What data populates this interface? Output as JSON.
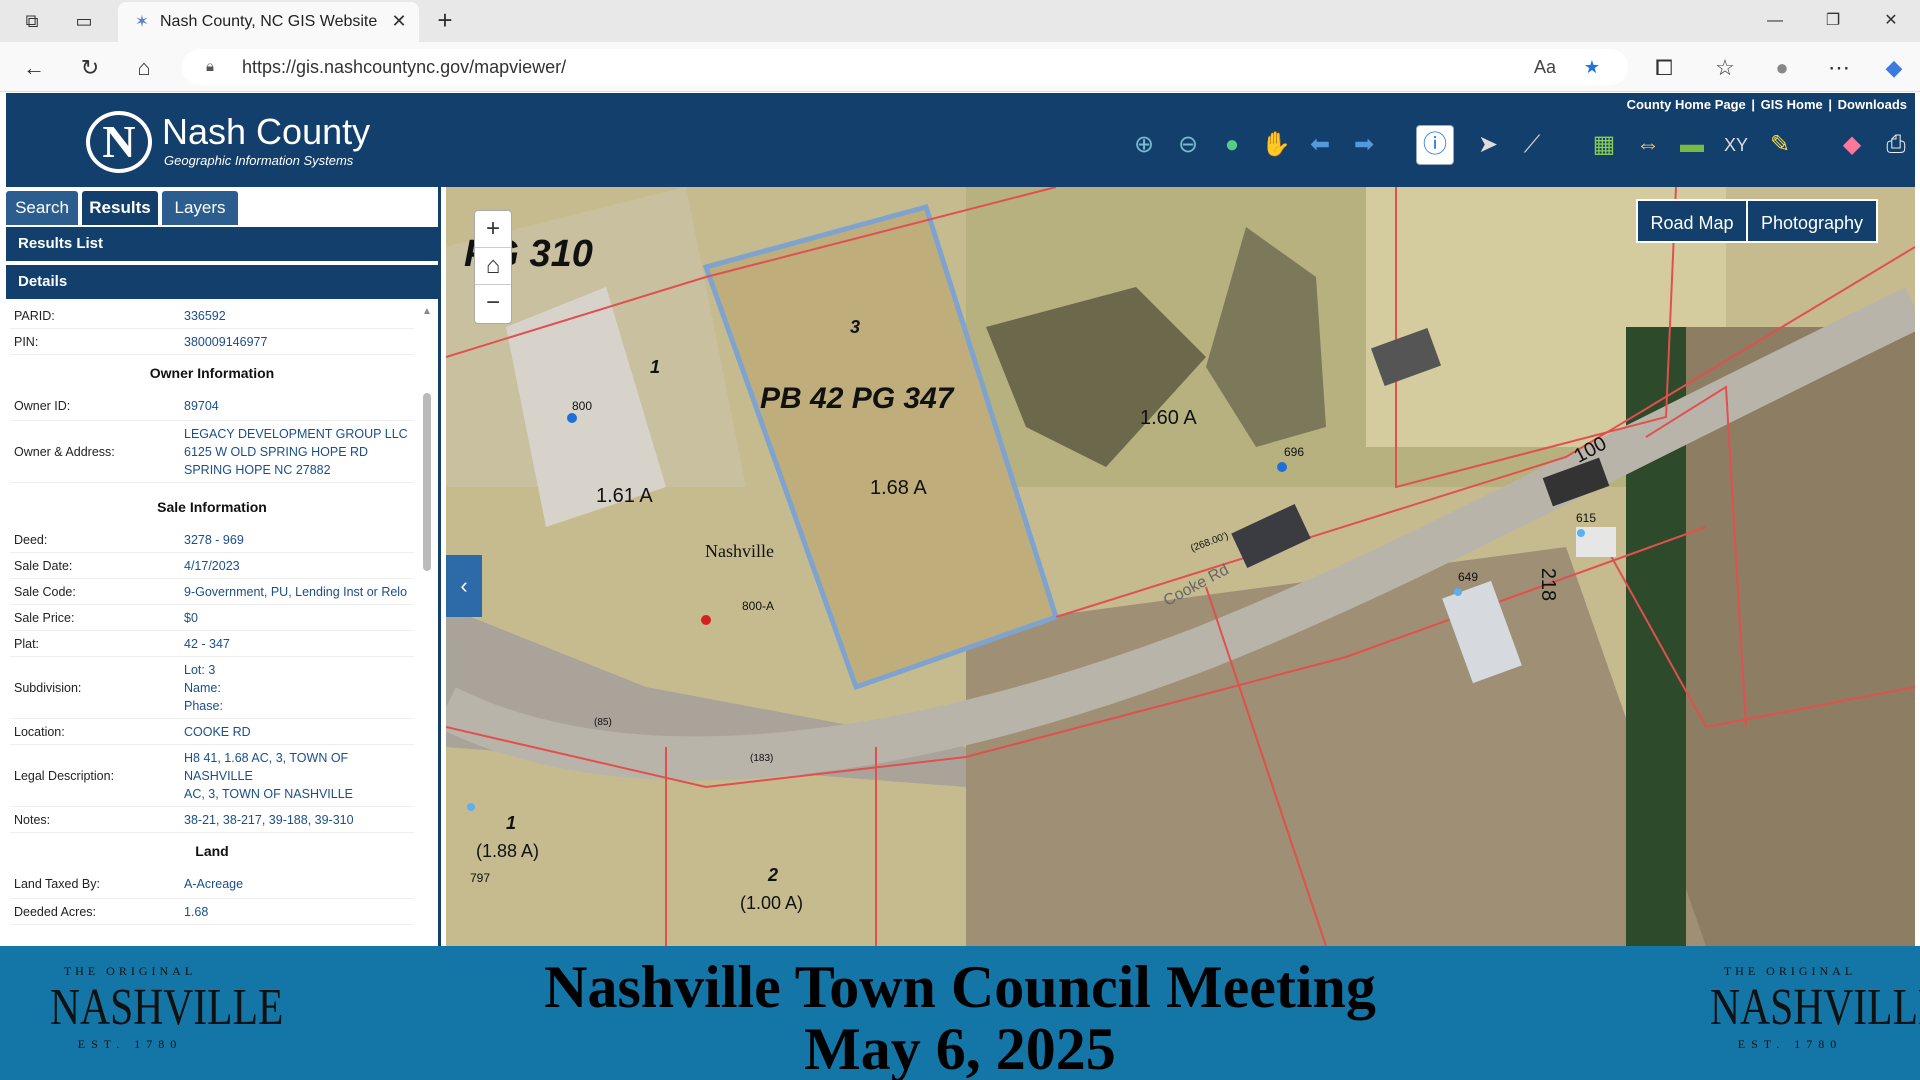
{
  "browser": {
    "tab_title": "Nash County, NC GIS Website",
    "url": "https://gis.nashcountync.gov/mapviewer/"
  },
  "header": {
    "logo_name": "Nash County",
    "logo_sub": "Geographic Information Systems",
    "links": [
      "County Home Page",
      "GIS Home",
      "Downloads"
    ],
    "tools": [
      "zoom-in-icon",
      "zoom-out-icon",
      "globe-icon",
      "pan-hand-icon",
      "back-arrow-icon",
      "forward-arrow-icon",
      "info-icon",
      "select-pointer-icon",
      "measure-icon",
      "map-icon",
      "distance-icon",
      "layer-icon",
      "xy-icon",
      "pencil-icon",
      "eraser-icon",
      "print-icon"
    ]
  },
  "panel": {
    "tabs": [
      "Search",
      "Results",
      "Layers"
    ],
    "selected_tab": "Results",
    "results_list_label": "Results List",
    "details_label": "Details",
    "parid_label": "PARID:",
    "parid": "336592",
    "pin_label": "PIN:",
    "pin": "380009146977",
    "owner_heading": "Owner Information",
    "owner_id_label": "Owner ID:",
    "owner_id": "89704",
    "owner_address_label": "Owner & Address:",
    "owner_line1": "LEGACY DEVELOPMENT GROUP LLC",
    "owner_line2": "6125 W OLD SPRING HOPE RD",
    "owner_line3": "SPRING HOPE NC 27882",
    "sale_heading": "Sale Information",
    "deed_label": "Deed:",
    "deed": "3278 - 969",
    "sale_date_label": "Sale Date:",
    "sale_date": "4/17/2023",
    "sale_code_label": "Sale Code:",
    "sale_code": "9-Government, PU, Lending Inst or Relo",
    "sale_price_label": "Sale Price:",
    "sale_price": "$0",
    "plat_label": "Plat:",
    "plat": "42 - 347",
    "subdivision_label": "Subdivision:",
    "sub_lot": "Lot: 3",
    "sub_name": "Name:",
    "sub_phase": "Phase:",
    "location_label": "Location:",
    "location": "COOKE RD",
    "legal_label": "Legal Description:",
    "legal1": "H8 41, 1.68 AC, 3, TOWN OF",
    "legal2": "NASHVILLE",
    "legal3": "AC, 3, TOWN OF NASHVILLE",
    "notes_label": "Notes:",
    "notes": "38-21, 38-217, 39-188, 39-310",
    "land_heading": "Land",
    "land_taxed_label": "Land Taxed By:",
    "land_taxed": "A-Acreage",
    "deeded_acres_label": "Deeded Acres:",
    "deeded_acres": "1.68"
  },
  "map": {
    "basemap_buttons": [
      "Road Map",
      "Photography"
    ],
    "labels": {
      "pg310": "PG 310",
      "plat": "PB 42  PG 347",
      "lot3": "3",
      "lot1": "1",
      "acres_168": "1.68 A",
      "acres_161": "1.61 A",
      "acres_160": "1.60 A",
      "nashville": "Nashville",
      "addr_800": "800",
      "addr_800a": "800-A",
      "addr_696": "696",
      "addr_615": "615",
      "addr_649": "649",
      "addr_797": "797",
      "road": "Cooke Rd",
      "n100": "100",
      "n218": "218",
      "lot1b": "1",
      "acres_188": "(1.88 A)",
      "lot2": "2",
      "acres_100": "(1.00 A)",
      "d268": "(268.00')",
      "d183": "(183)",
      "d85": "(85)"
    }
  },
  "banner": {
    "title_line1": "Nashville Town Council Meeting",
    "title_line2": "May 6, 2025",
    "logo_top": "THE ORIGINAL",
    "logo_main": "NASHVILLE",
    "logo_est": "EST. 1780"
  },
  "colors": {
    "header_bg": "#123f6b",
    "banner_bg": "#1476a6",
    "link": "#1a4f8a",
    "parcel_line": "#e05050",
    "selected_parcel": "#7fa3cf"
  }
}
